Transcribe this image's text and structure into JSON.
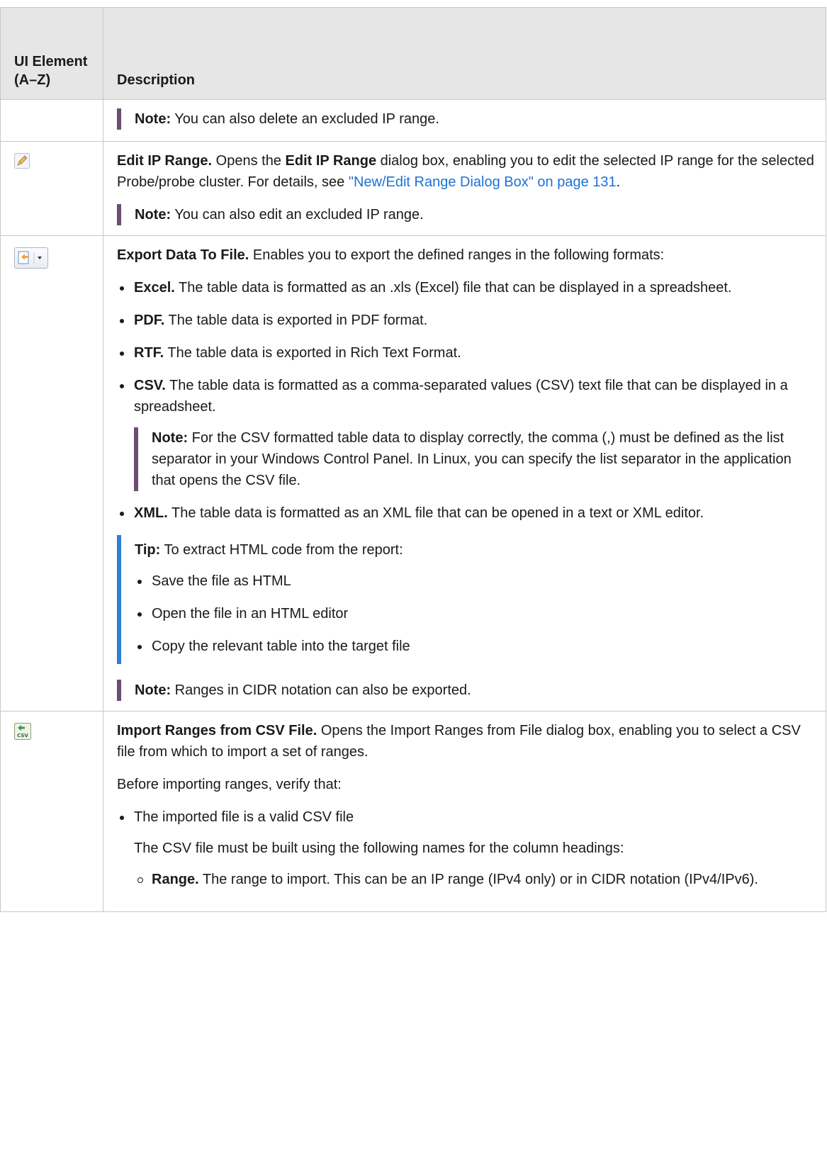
{
  "table": {
    "header": {
      "col1": "UI Element (A–Z)",
      "col2": "Description"
    },
    "row_delete": {
      "note_label": "Note:",
      "note_text": " You can also delete an excluded IP range."
    },
    "row_edit": {
      "icon": "pencil-icon",
      "title": "Edit IP Range.",
      "text_a": " Opens the ",
      "dialog": "Edit IP Range",
      "text_b": " dialog box, enabling you to edit the selected IP range for the selected Probe/probe cluster. For details, see ",
      "link": "\"New/Edit Range Dialog Box\" on page 131",
      "text_c": ".",
      "note_label": "Note:",
      "note_text": " You can also edit an excluded IP range."
    },
    "row_export": {
      "icon": "export-icon",
      "title": "Export Data To File.",
      "intro": " Enables you to export the defined ranges in the following formats:",
      "formats": [
        {
          "name": "Excel.",
          "text": " The table data is formatted as an .xls (Excel) file that can be displayed in a spreadsheet."
        },
        {
          "name": "PDF.",
          "text": " The table data is exported in PDF format."
        },
        {
          "name": "RTF.",
          "text": " The table data is exported in Rich Text Format."
        },
        {
          "name": "CSV.",
          "text": " The table data is formatted as a comma-separated values (CSV) text file that can be displayed in a spreadsheet."
        }
      ],
      "csv_note_label": "Note:",
      "csv_note_text": " For the CSV formatted table data to display correctly, the comma (,) must be defined as the list separator in your Windows Control Panel. In Linux, you can specify the list separator in the application that opens the CSV file.",
      "xml": {
        "name": "XML.",
        "text": " The table data is formatted as an XML file that can be opened in a text or XML editor."
      },
      "tip_label": "Tip:",
      "tip_text": " To extract HTML code from the report:",
      "tip_steps": [
        "Save the file as HTML",
        "Open the file in an HTML editor",
        "Copy the relevant table into the target file"
      ],
      "note_label": "Note:",
      "note_text": " Ranges in CIDR notation can also be exported."
    },
    "row_import": {
      "icon": "import-csv-icon",
      "title": "Import Ranges from CSV File.",
      "text": " Opens the Import Ranges from File dialog box, enabling you to select a CSV file from which to import a set of ranges.",
      "verify": "Before importing ranges, verify that:",
      "item1": "The imported file is a valid CSV file",
      "item1_sub": "The CSV file must be built using the following names for the column headings:",
      "range_name": "Range.",
      "range_text": " The range to import. This can be an IP range (IPv4 only) or in CIDR notation (IPv4/IPv6)."
    }
  },
  "colors": {
    "note_bar": "#6b4e71",
    "tip_bar": "#2e7fd6",
    "link": "#1b73d6",
    "header_bg": "#e6e6e6"
  }
}
